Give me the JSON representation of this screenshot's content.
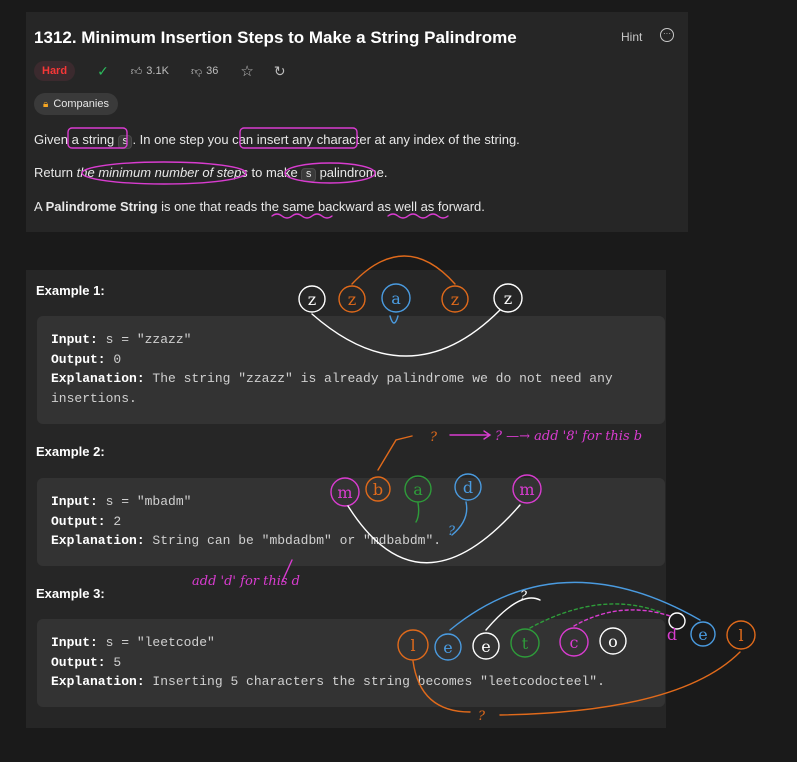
{
  "problem": {
    "title": "1312. Minimum Insertion Steps to Make a String Palindrome",
    "hint_label": "Hint",
    "difficulty": "Hard",
    "likes": "3.1K",
    "dislikes": "36",
    "companies_label": "Companies"
  },
  "description": {
    "p1": {
      "a": "Given ",
      "b": "a string ",
      "c": "s",
      "d": ". In one step you can ",
      "e": "insert any character",
      "f": " at any index of the string."
    },
    "p2": {
      "a": "Return ",
      "b": "the minimum number of steps",
      "c": " to make ",
      "d": "s",
      "e": " palindrome."
    },
    "p3": {
      "a": "A ",
      "b": "Palindrome String",
      "c": " is one that reads the same backward as well as forward."
    }
  },
  "examples": [
    {
      "label": "Example 1:",
      "input_key": "Input:",
      "input_val": " s = \"zzazz\"",
      "output_key": "Output:",
      "output_val": " 0",
      "explanation_key": "Explanation:",
      "explanation_val": " The string \"zzazz\" is already palindrome we do not need any",
      "explanation_val2": "insertions."
    },
    {
      "label": "Example 2:",
      "input_key": "Input:",
      "input_val": " s = \"mbadm\"",
      "output_key": "Output:",
      "output_val": " 2",
      "explanation_key": "Explanation:",
      "explanation_val": " String can be \"mbdadbm\" or \"mdbabdm\"."
    },
    {
      "label": "Example 3:",
      "input_key": "Input:",
      "input_val": " s = \"leetcode\"",
      "output_key": "Output:",
      "output_val": " 5",
      "explanation_key": "Explanation:",
      "explanation_val": " Inserting 5 characters the string becomes \"leetcodocteel\"."
    }
  ],
  "annotations": {
    "ex1_letters": [
      "z",
      "z",
      "a",
      "z",
      "z"
    ],
    "ex2_note": "? —→ add '8' for this b",
    "ex2_letters": [
      "m",
      "b",
      "a",
      "d",
      "m"
    ],
    "ex2_note2": "add 'd' for this d",
    "ex3_letters": [
      "l",
      "e",
      "e",
      "t",
      "c",
      "o",
      "d",
      "e",
      "l"
    ],
    "q": "?"
  },
  "colors": {
    "accent_pink": "#d93cd0",
    "orange": "#e06a1b",
    "blue": "#4a9be0",
    "green": "#2e9c3a",
    "hard_red": "#f63737",
    "check_green": "#2cbb5d"
  }
}
